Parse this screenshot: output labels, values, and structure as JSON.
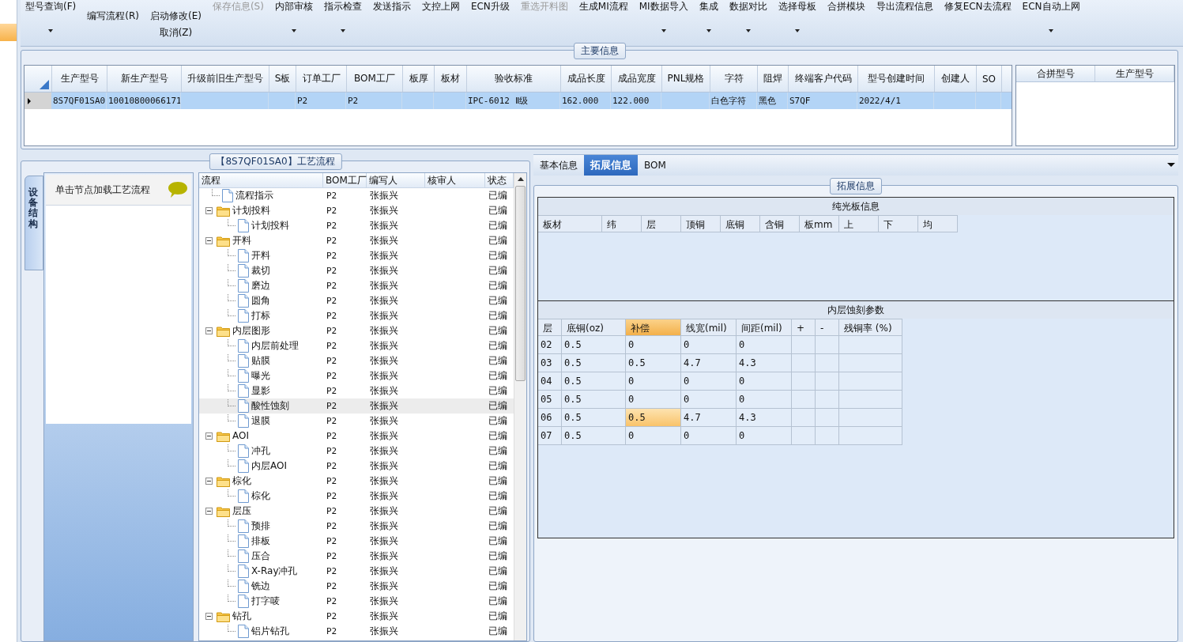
{
  "toolbar": [
    {
      "kind": "large",
      "label": "型号查询(F)",
      "dropdown": true,
      "disabled": false
    },
    {
      "kind": "small",
      "label": "编写流程(R)",
      "dropdown": false,
      "disabled": false
    },
    {
      "kind": "stack",
      "label": "启动修改(E)",
      "label2": "取消(Z)",
      "dropdown": false,
      "disabled": false
    },
    {
      "kind": "large",
      "label": "保存信息(S)",
      "dropdown": false,
      "disabled": true
    },
    {
      "kind": "large",
      "label": "内部审核",
      "dropdown": true,
      "disabled": false
    },
    {
      "kind": "large",
      "label": "指示检查",
      "dropdown": true,
      "disabled": false
    },
    {
      "kind": "large",
      "label": "发送指示",
      "dropdown": false,
      "disabled": false
    },
    {
      "kind": "large",
      "label": "文控上网",
      "dropdown": false,
      "disabled": false
    },
    {
      "kind": "large",
      "label": "ECN升级",
      "dropdown": false,
      "disabled": false
    },
    {
      "kind": "large",
      "label": "重选开料图",
      "dropdown": false,
      "disabled": true
    },
    {
      "kind": "large",
      "label": "生成MI流程",
      "dropdown": false,
      "disabled": false
    },
    {
      "kind": "large",
      "label": "MI数据导入",
      "dropdown": true,
      "disabled": false
    },
    {
      "kind": "large",
      "label": "集成",
      "dropdown": true,
      "disabled": false
    },
    {
      "kind": "large",
      "label": "数据对比",
      "dropdown": true,
      "disabled": false
    },
    {
      "kind": "large",
      "label": "选择母板",
      "dropdown": true,
      "disabled": false
    },
    {
      "kind": "large",
      "label": "合拼模块",
      "dropdown": false,
      "disabled": false
    },
    {
      "kind": "large",
      "label": "导出流程信息",
      "dropdown": false,
      "disabled": false
    },
    {
      "kind": "large",
      "label": "修复ECN去流程",
      "dropdown": false,
      "disabled": false
    },
    {
      "kind": "large",
      "label": "ECN自动上网",
      "dropdown": true,
      "disabled": false
    }
  ],
  "main_info": {
    "title": "主要信息",
    "row_selected": true,
    "columns": [
      {
        "label": "生产型号",
        "value": "8S7QF01SA0"
      },
      {
        "label": "新生产型号",
        "value": "10010800066171"
      },
      {
        "label": "升级前旧生产型号"
      },
      {
        "label": "S板"
      },
      {
        "label": "订单工厂",
        "value": "P2"
      },
      {
        "label": "BOM工厂",
        "value": "P2"
      },
      {
        "label": "板厚"
      },
      {
        "label": "板材"
      },
      {
        "label": "验收标准",
        "value": "IPC-6012 Ⅱ级"
      },
      {
        "label": "成品长度",
        "value": "162.000"
      },
      {
        "label": "成品宽度",
        "value": "122.000"
      },
      {
        "label": "PNL规格"
      },
      {
        "label": "字符",
        "value": "白色字符"
      },
      {
        "label": "阻焊",
        "value": "黑色"
      },
      {
        "label": "终端客户代码",
        "value": "S7QF"
      },
      {
        "label": "型号创建时间",
        "value": "2022/4/1"
      },
      {
        "label": "创建人"
      },
      {
        "label": "SO"
      }
    ],
    "merge_columns": [
      "合拼型号",
      "生产型号"
    ]
  },
  "process": {
    "title": "【8S7QF01SA0】工艺流程",
    "side_tab": "设备结构",
    "hint": "单击节点加载工艺流程",
    "columns": [
      "流程",
      "BOM工厂",
      "编写人",
      "核审人",
      "状态"
    ],
    "tree": [
      {
        "kind": "file",
        "name": "流程指示",
        "bom": "P2",
        "author": "张振兴",
        "status": "已编",
        "selected": false
      },
      {
        "kind": "folder",
        "name": "计划投料",
        "bom": "P2",
        "author": "张振兴",
        "status": "已编",
        "selected": false,
        "expanded": true,
        "children": [
          {
            "kind": "file",
            "name": "计划投料",
            "bom": "P2",
            "author": "张振兴",
            "status": "已编",
            "selected": false
          }
        ]
      },
      {
        "kind": "folder",
        "name": "开料",
        "bom": "P2",
        "author": "张振兴",
        "status": "已编",
        "selected": false,
        "expanded": true,
        "children": [
          {
            "kind": "file",
            "name": "开料",
            "bom": "P2",
            "author": "张振兴",
            "status": "已编",
            "selected": false
          },
          {
            "kind": "file",
            "name": "裁切",
            "bom": "P2",
            "author": "张振兴",
            "status": "已编",
            "selected": false
          },
          {
            "kind": "file",
            "name": "磨边",
            "bom": "P2",
            "author": "张振兴",
            "status": "已编",
            "selected": false
          },
          {
            "kind": "file",
            "name": "圆角",
            "bom": "P2",
            "author": "张振兴",
            "status": "已编",
            "selected": false
          },
          {
            "kind": "file",
            "name": "打标",
            "bom": "P2",
            "author": "张振兴",
            "status": "已编",
            "selected": false
          }
        ]
      },
      {
        "kind": "folder",
        "name": "内层图形",
        "bom": "P2",
        "author": "张振兴",
        "status": "已编",
        "selected": false,
        "expanded": true,
        "children": [
          {
            "kind": "file",
            "name": "内层前处理",
            "bom": "P2",
            "author": "张振兴",
            "status": "已编",
            "selected": false
          },
          {
            "kind": "file",
            "name": "贴膜",
            "bom": "P2",
            "author": "张振兴",
            "status": "已编",
            "selected": false
          },
          {
            "kind": "file",
            "name": "曝光",
            "bom": "P2",
            "author": "张振兴",
            "status": "已编",
            "selected": false
          },
          {
            "kind": "file",
            "name": "显影",
            "bom": "P2",
            "author": "张振兴",
            "status": "已编",
            "selected": false
          },
          {
            "kind": "file",
            "name": "酸性蚀刻",
            "bom": "P2",
            "author": "张振兴",
            "status": "已编",
            "selected": true
          },
          {
            "kind": "file",
            "name": "退膜",
            "bom": "P2",
            "author": "张振兴",
            "status": "已编",
            "selected": false
          }
        ]
      },
      {
        "kind": "folder",
        "name": "AOI",
        "bom": "P2",
        "author": "张振兴",
        "status": "已编",
        "selected": false,
        "expanded": true,
        "children": [
          {
            "kind": "file",
            "name": "冲孔",
            "bom": "P2",
            "author": "张振兴",
            "status": "已编",
            "selected": false
          },
          {
            "kind": "file",
            "name": "内层AOI",
            "bom": "P2",
            "author": "张振兴",
            "status": "已编",
            "selected": false
          }
        ]
      },
      {
        "kind": "folder",
        "name": "棕化",
        "bom": "P2",
        "author": "张振兴",
        "status": "已编",
        "selected": false,
        "expanded": true,
        "children": [
          {
            "kind": "file",
            "name": "棕化",
            "bom": "P2",
            "author": "张振兴",
            "status": "已编",
            "selected": false
          }
        ]
      },
      {
        "kind": "folder",
        "name": "层压",
        "bom": "P2",
        "author": "张振兴",
        "status": "已编",
        "selected": false,
        "expanded": true,
        "children": [
          {
            "kind": "file",
            "name": "预排",
            "bom": "P2",
            "author": "张振兴",
            "status": "已编",
            "selected": false
          },
          {
            "kind": "file",
            "name": "排板",
            "bom": "P2",
            "author": "张振兴",
            "status": "已编",
            "selected": false
          },
          {
            "kind": "file",
            "name": "压合",
            "bom": "P2",
            "author": "张振兴",
            "status": "已编",
            "selected": false
          },
          {
            "kind": "file",
            "name": "X-Ray冲孔",
            "bom": "P2",
            "author": "张振兴",
            "status": "已编",
            "selected": false
          },
          {
            "kind": "file",
            "name": "铣边",
            "bom": "P2",
            "author": "张振兴",
            "status": "已编",
            "selected": false
          },
          {
            "kind": "file",
            "name": "打字唛",
            "bom": "P2",
            "author": "张振兴",
            "status": "已编",
            "selected": false
          }
        ]
      },
      {
        "kind": "folder",
        "name": "钻孔",
        "bom": "P2",
        "author": "张振兴",
        "status": "已编",
        "selected": false,
        "expanded": true,
        "children": [
          {
            "kind": "file",
            "name": "铝片钻孔",
            "bom": "P2",
            "author": "张振兴",
            "status": "已编",
            "selected": false
          }
        ]
      }
    ]
  },
  "detail": {
    "tabs": [
      {
        "label": "基本信息",
        "selected": false
      },
      {
        "label": "拓展信息",
        "selected": true
      },
      {
        "label": "BOM",
        "selected": false
      }
    ],
    "group_title": "拓展信息",
    "bare_board": {
      "title": "纯光板信息",
      "columns": [
        "板材",
        "纬",
        "层",
        "顶铜",
        "底铜",
        "含铜",
        "板mm",
        "上",
        "下",
        "均"
      ]
    },
    "inner_etch": {
      "title": "内层蚀刻参数",
      "columns": [
        {
          "label": "层",
          "selected": false
        },
        {
          "label": "底铜(oz)",
          "selected": false
        },
        {
          "label": "补偿",
          "selected": true
        },
        {
          "label": "线宽(mil)",
          "selected": false
        },
        {
          "label": "间距(mil)",
          "selected": false
        },
        {
          "label": "+",
          "selected": false
        },
        {
          "label": "-",
          "selected": false
        },
        {
          "label": "残铜率 (%)",
          "selected": false
        }
      ],
      "rows": [
        {
          "cells": [
            "02",
            "0.5",
            "0",
            "0",
            "0"
          ],
          "selected": false
        },
        {
          "cells": [
            "03",
            "0.5",
            "0.5",
            "4.7",
            "4.3"
          ],
          "selected": false
        },
        {
          "cells": [
            "04",
            "0.5",
            "0",
            "0",
            "0"
          ],
          "selected": false
        },
        {
          "cells": [
            "05",
            "0.5",
            "0",
            "0",
            "0"
          ],
          "selected": false
        },
        {
          "cells": [
            "06",
            "0.5",
            "0.5",
            "4.7",
            "4.3"
          ],
          "selected": true
        },
        {
          "cells": [
            "07",
            "0.5",
            "0",
            "0",
            "0"
          ],
          "selected": false
        }
      ]
    }
  }
}
